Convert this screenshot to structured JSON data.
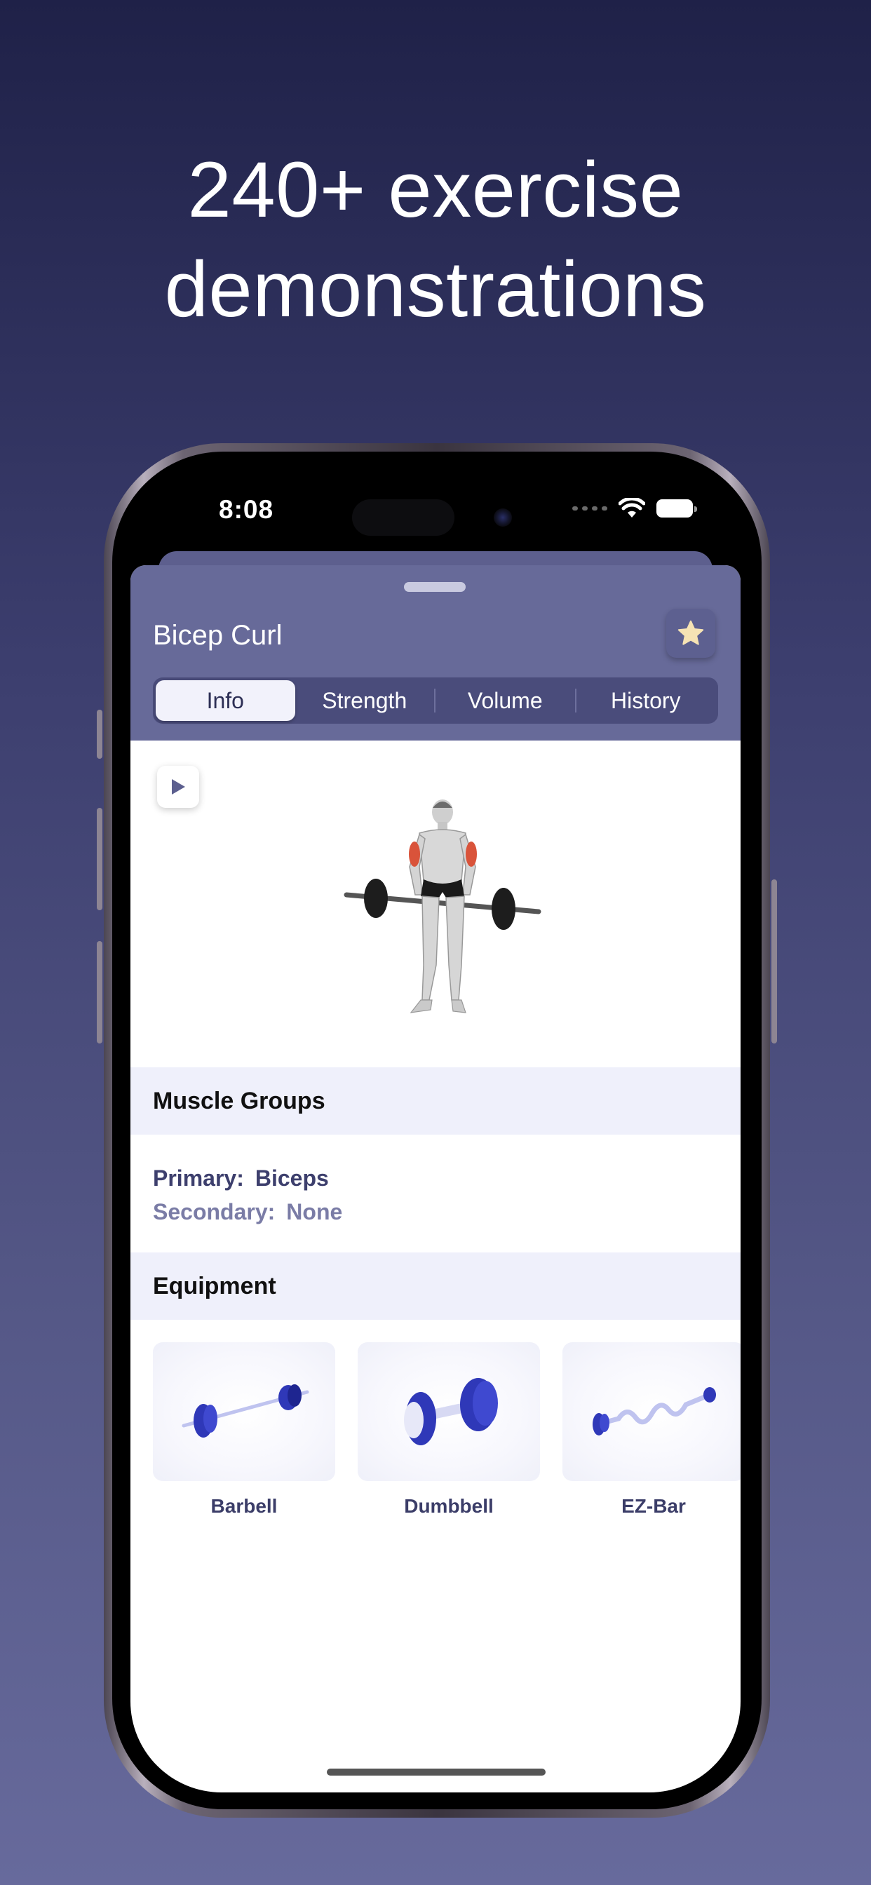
{
  "headline": {
    "line1": "240+ exercise",
    "line2": "demonstrations"
  },
  "status_bar": {
    "time": "8:08"
  },
  "exercise": {
    "title": "Bicep Curl",
    "tabs": [
      {
        "label": "Info",
        "active": true
      },
      {
        "label": "Strength",
        "active": false
      },
      {
        "label": "Volume",
        "active": false
      },
      {
        "label": "History",
        "active": false
      }
    ]
  },
  "muscle_groups": {
    "heading": "Muscle Groups",
    "primary_label": "Primary:",
    "primary_value": "Biceps",
    "secondary_label": "Secondary:",
    "secondary_value": "None"
  },
  "equipment": {
    "heading": "Equipment",
    "items": [
      {
        "label": "Barbell",
        "icon": "barbell-icon"
      },
      {
        "label": "Dumbbell",
        "icon": "dumbbell-icon"
      },
      {
        "label": "EZ-Bar",
        "icon": "ez-bar-icon"
      }
    ]
  },
  "colors": {
    "header_bg": "#676a99",
    "segment_bg": "#4a4c7b",
    "accent_star": "#f6e3b4",
    "equipment_blue": "#2f38b8"
  }
}
